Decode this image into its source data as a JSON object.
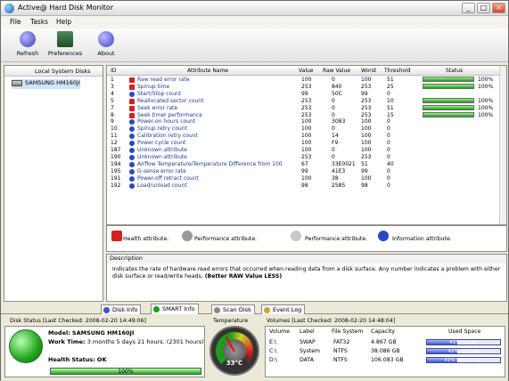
{
  "window": {
    "title": "Active@ Hard Disk Monitor",
    "min": "_",
    "max": "□",
    "close": "×"
  },
  "menu": [
    "File",
    "Tasks",
    "Help"
  ],
  "toolbar": [
    {
      "label": "Refresh",
      "icon": "refresh-icon",
      "color": "#3a3fb5"
    },
    {
      "label": "Preferences",
      "icon": "preferences-icon",
      "color": "#2d6a3b"
    },
    {
      "label": "About",
      "icon": "about-icon",
      "color": "#4343c7"
    }
  ],
  "sidebar": {
    "header": "Local System Disks",
    "drive": "SAMSUNG HM160JI"
  },
  "grid": {
    "columns": [
      "ID",
      "Attribute Name",
      "Value",
      "Raw Value",
      "Worst",
      "Threshold",
      "Status"
    ],
    "rows": [
      {
        "id": "1",
        "name": "Raw read error rate",
        "value": "100",
        "raw": "0",
        "worst": "100",
        "thr": "51",
        "status": 100,
        "pct": "100%",
        "warn": true
      },
      {
        "id": "3",
        "name": "Spinup time",
        "value": "253",
        "raw": "840",
        "worst": "253",
        "thr": "25",
        "status": 100,
        "pct": "100%",
        "warn": true
      },
      {
        "id": "4",
        "name": "Start/Stop count",
        "value": "99",
        "raw": "50C",
        "worst": "99",
        "thr": "0",
        "status": null,
        "pct": "",
        "warn": false
      },
      {
        "id": "5",
        "name": "Reallocated sector count",
        "value": "253",
        "raw": "0",
        "worst": "253",
        "thr": "10",
        "status": 100,
        "pct": "100%",
        "warn": true
      },
      {
        "id": "7",
        "name": "Seek error rate",
        "value": "253",
        "raw": "0",
        "worst": "253",
        "thr": "51",
        "status": 100,
        "pct": "100%",
        "warn": true
      },
      {
        "id": "8",
        "name": "Seek timer performance",
        "value": "253",
        "raw": "0",
        "worst": "253",
        "thr": "15",
        "status": 100,
        "pct": "100%",
        "warn": true
      },
      {
        "id": "9",
        "name": "Power-on hours count",
        "value": "100",
        "raw": "3083",
        "worst": "100",
        "thr": "0",
        "status": null,
        "pct": "",
        "warn": false
      },
      {
        "id": "10",
        "name": "Spinup retry count",
        "value": "100",
        "raw": "0",
        "worst": "100",
        "thr": "0",
        "status": null,
        "pct": "",
        "warn": false
      },
      {
        "id": "11",
        "name": "Calibration retry count",
        "value": "100",
        "raw": "14",
        "worst": "100",
        "thr": "0",
        "status": null,
        "pct": "",
        "warn": false
      },
      {
        "id": "12",
        "name": "Power cycle count",
        "value": "100",
        "raw": "F9",
        "worst": "100",
        "thr": "0",
        "status": null,
        "pct": "",
        "warn": false
      },
      {
        "id": "187",
        "name": "Unknown attribute",
        "value": "100",
        "raw": "0",
        "worst": "100",
        "thr": "0",
        "status": null,
        "pct": "",
        "warn": false
      },
      {
        "id": "190",
        "name": "Unknown attribute",
        "value": "253",
        "raw": "0",
        "worst": "253",
        "thr": "0",
        "status": null,
        "pct": "",
        "warn": false
      },
      {
        "id": "194",
        "name": "Airflow Temperature/Temperature Difference from 100",
        "value": "67",
        "raw": "33E0021",
        "worst": "51",
        "thr": "40",
        "status": null,
        "pct": "",
        "warn": false
      },
      {
        "id": "195",
        "name": "G-sense error rate",
        "value": "99",
        "raw": "41E3",
        "worst": "99",
        "thr": "0",
        "status": null,
        "pct": "",
        "warn": false
      },
      {
        "id": "191",
        "name": "Power-off retract count",
        "value": "100",
        "raw": "38",
        "worst": "100",
        "thr": "0",
        "status": null,
        "pct": "",
        "warn": false
      },
      {
        "id": "192",
        "name": "Load/unload count",
        "value": "98",
        "raw": "2585",
        "worst": "98",
        "thr": "0",
        "status": null,
        "pct": "",
        "warn": false
      }
    ]
  },
  "legend": {
    "health": "Health attribute.",
    "performance": "Performance attribute.",
    "performance2": "Performance attribute.",
    "information": "Information attribute."
  },
  "description": {
    "title": "Description",
    "text": "Indicates the rate of hardware read errors that occurred when reading data from a disk surface. Any number indicates a problem with either disk surface or read/write heads.",
    "emphasis": "(Better RAW Value LESS)"
  },
  "tabs": [
    "Disk Info",
    "SMART Info",
    "Scan Disk",
    "Event Log"
  ],
  "status": {
    "header": "Disk Status [Last Checked: 2008-02-20 14:49:06]",
    "model_label": "Model:",
    "model": "SAMSUNG HM160JI",
    "worktime_label": "Work Time:",
    "worktime": "3 months 5 days 21 hours. (2301 hours)",
    "health_label": "Health Status:",
    "health": "OK",
    "health_pct_label": "100%",
    "health_pct": 100
  },
  "temperature": {
    "title": "Temperature",
    "value": "33°C"
  },
  "volumes": {
    "header": "Volumes [Last Checked: 2008-02-20 14:48:04]",
    "columns": [
      "Volume",
      "Label",
      "File System",
      "Capacity",
      "Used Space"
    ],
    "rows": [
      {
        "vol": "E:\\",
        "label": "SWAP",
        "fs": "FAT32",
        "cap": "4.867 GB",
        "used_label": "41% (2 GB)",
        "used": 41
      },
      {
        "vol": "C:\\",
        "label": "System",
        "fs": "NTFS",
        "cap": "38.086 GB",
        "used_label": "42% (16 GB)",
        "used": 42
      },
      {
        "vol": "D:\\",
        "label": "DATA",
        "fs": "NTFS",
        "cap": "106.083 GB",
        "used_label": "41% (43.53 GB)",
        "used": 41
      }
    ]
  }
}
